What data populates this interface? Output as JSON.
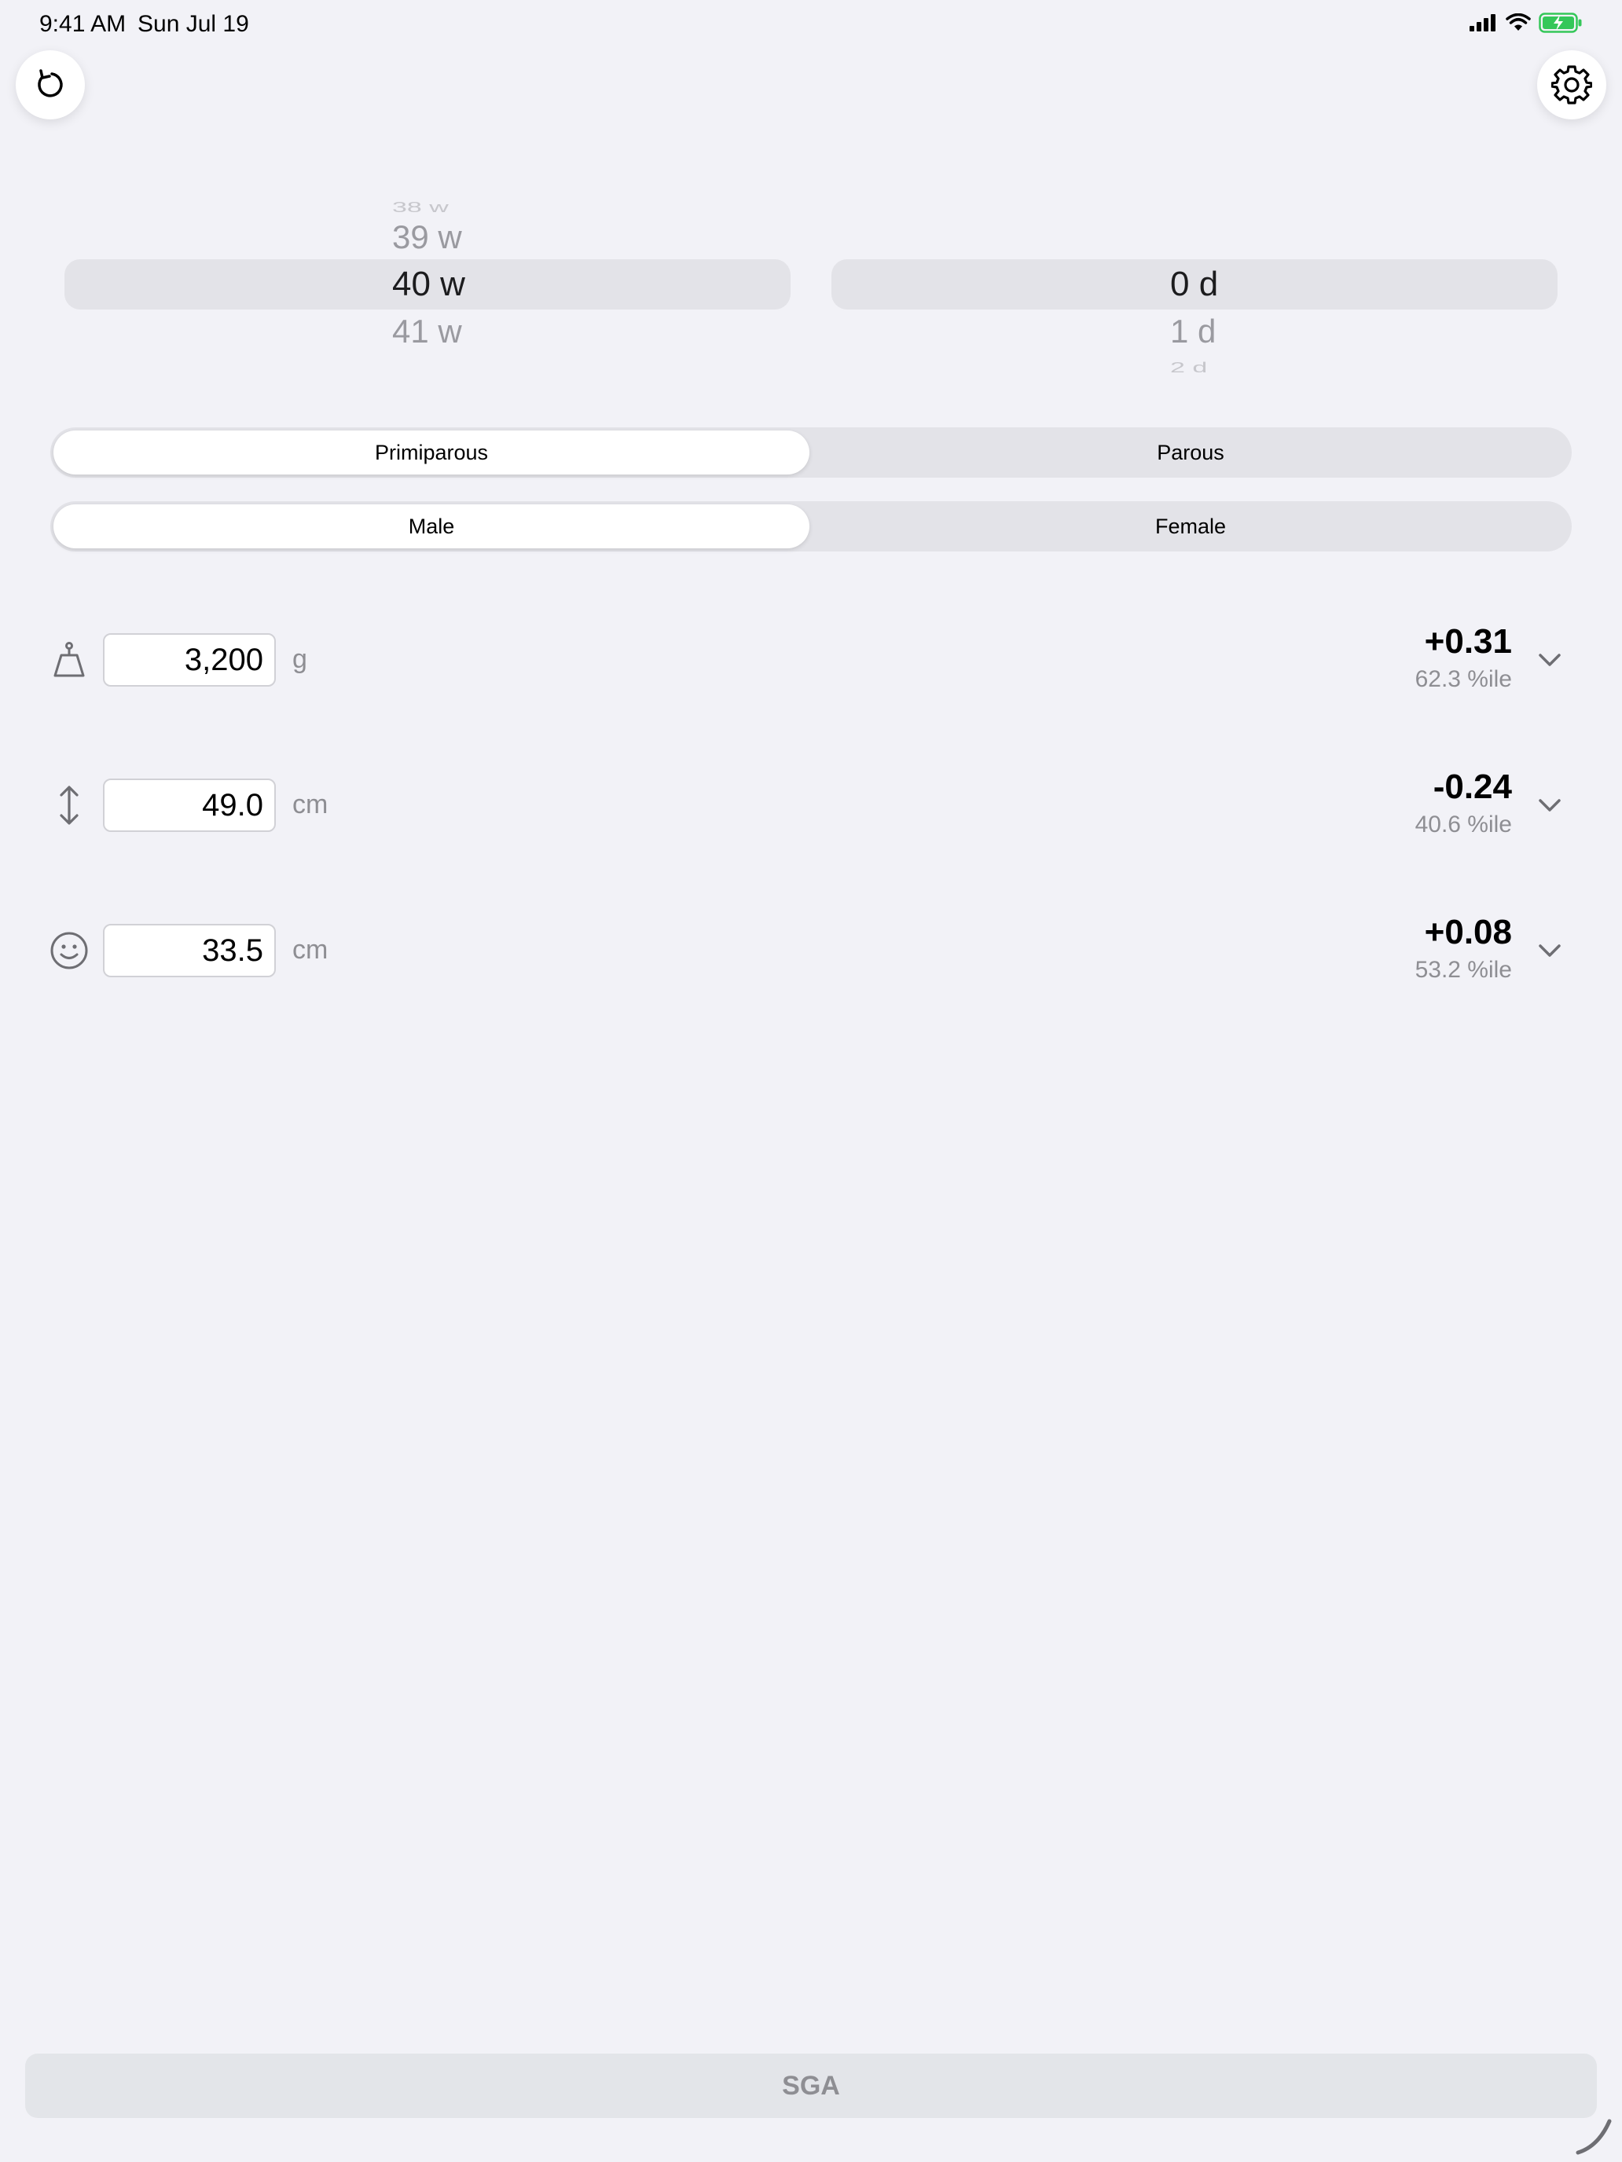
{
  "status_bar": {
    "time": "9:41 AM",
    "date": "Sun Jul 19"
  },
  "toolbar": {
    "reset_icon": "reset-icon",
    "settings_icon": "gear-icon"
  },
  "gestational_age": {
    "weeks": [
      "38 w",
      "39 w",
      "40 w",
      "41 w"
    ],
    "selected_week": "40 w",
    "days": [
      "0 d",
      "1 d",
      "2 d"
    ],
    "selected_day": "0 d"
  },
  "parity": {
    "options": [
      "Primiparous",
      "Parous"
    ],
    "selected": "Primiparous"
  },
  "sex": {
    "options": [
      "Male",
      "Female"
    ],
    "selected": "Male"
  },
  "measurements": [
    {
      "icon": "weight-icon",
      "value": "3,200",
      "unit": "g",
      "zscore": "+0.31",
      "percentile": "62.3 %ile"
    },
    {
      "icon": "length-icon",
      "value": "49.0",
      "unit": "cm",
      "zscore": "-0.24",
      "percentile": "40.6 %ile"
    },
    {
      "icon": "face-icon",
      "value": "33.5",
      "unit": "cm",
      "zscore": "+0.08",
      "percentile": "53.2 %ile"
    }
  ],
  "result_button": {
    "label": "SGA"
  },
  "colors": {
    "background": "#f2f2f7",
    "segment_track": "#e3e3e8",
    "secondary_text": "#8e8e93",
    "battery_green": "#34c759"
  }
}
